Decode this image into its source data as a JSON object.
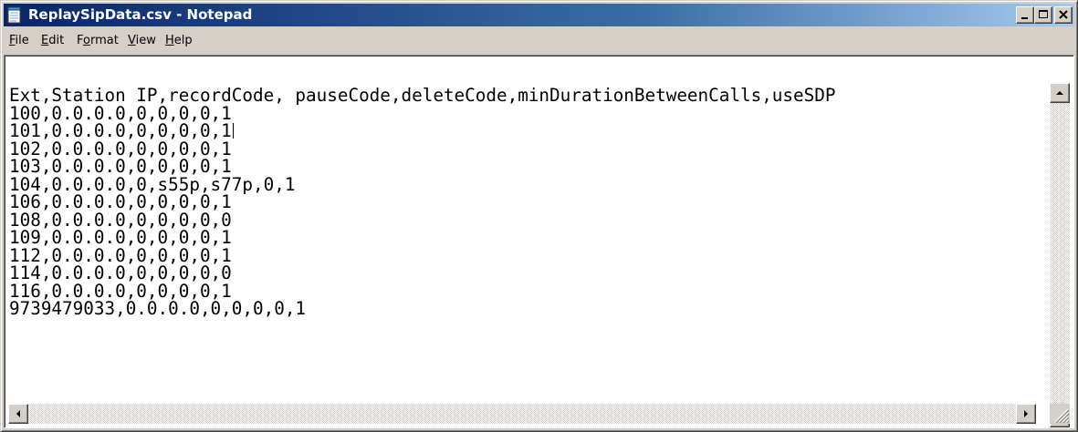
{
  "window": {
    "title": "ReplaySipData.csv - Notepad",
    "icon": "notepad-icon",
    "controls": [
      "minimize-icon",
      "maximize-icon",
      "close-icon"
    ]
  },
  "menu": {
    "items": [
      {
        "mnemonic": "F",
        "rest": "ile",
        "label": "File"
      },
      {
        "mnemonic": "E",
        "rest": "dit",
        "label": "Edit"
      },
      {
        "pre": "F",
        "mnemonic": "o",
        "rest": "rmat",
        "label": "Format"
      },
      {
        "mnemonic": "V",
        "rest": "iew",
        "label": "View"
      },
      {
        "mnemonic": "H",
        "rest": "elp",
        "label": "Help"
      }
    ]
  },
  "document": {
    "lines": [
      "Ext,Station IP,recordCode, pauseCode,deleteCode,minDurationBetweenCalls,useSDP",
      "100,0.0.0.0,0,0,0,0,1",
      "101,0.0.0.0,0,0,0,0,1",
      "102,0.0.0.0,0,0,0,0,1",
      "103,0.0.0.0,0,0,0,0,1",
      "104,0.0.0.0,0,s55p,s77p,0,1",
      "106,0.0.0.0,0,0,0,0,1",
      "108,0.0.0.0,0,0,0,0,0",
      "109,0.0.0.0,0,0,0,0,1",
      "112,0.0.0.0,0,0,0,0,1",
      "114,0.0.0.0,0,0,0,0,0",
      "116,0.0.0.0,0,0,0,0,1",
      "9739479033,0.0.0.0,0,0,0,0,1"
    ],
    "caret_line": 2
  },
  "colors": {
    "titlebar_start": "#0a246a",
    "titlebar_end": "#a6caf0",
    "chrome": "#d4d0c8"
  }
}
